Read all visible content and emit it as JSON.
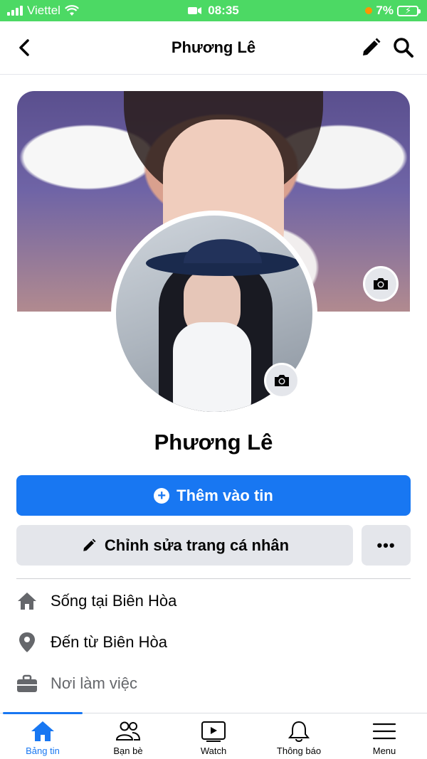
{
  "status_bar": {
    "carrier": "Viettel",
    "time": "08:35",
    "battery": "7%"
  },
  "header": {
    "title": "Phương Lê"
  },
  "profile": {
    "name": "Phương Lê",
    "add_story_label": "Thêm vào tin",
    "edit_profile_label": "Chỉnh sửa trang cá nhân",
    "more_label": "•••"
  },
  "details": [
    {
      "icon": "home-icon",
      "text": "Sống tại Biên Hòa"
    },
    {
      "icon": "location-pin-icon",
      "text": "Đến từ Biên Hòa"
    },
    {
      "icon": "briefcase-icon",
      "text": "Nơi làm việc"
    }
  ],
  "bottom_nav": [
    {
      "label": "Bảng tin",
      "icon": "home-icon",
      "active": true
    },
    {
      "label": "Bạn bè",
      "icon": "friends-icon",
      "active": false
    },
    {
      "label": "Watch",
      "icon": "watch-icon",
      "active": false
    },
    {
      "label": "Thông báo",
      "icon": "bell-icon",
      "active": false
    },
    {
      "label": "Menu",
      "icon": "menu-icon",
      "active": false
    }
  ],
  "colors": {
    "accent": "#1877f2",
    "status_bar": "#4cd964",
    "button_gray": "#e4e6eb"
  }
}
